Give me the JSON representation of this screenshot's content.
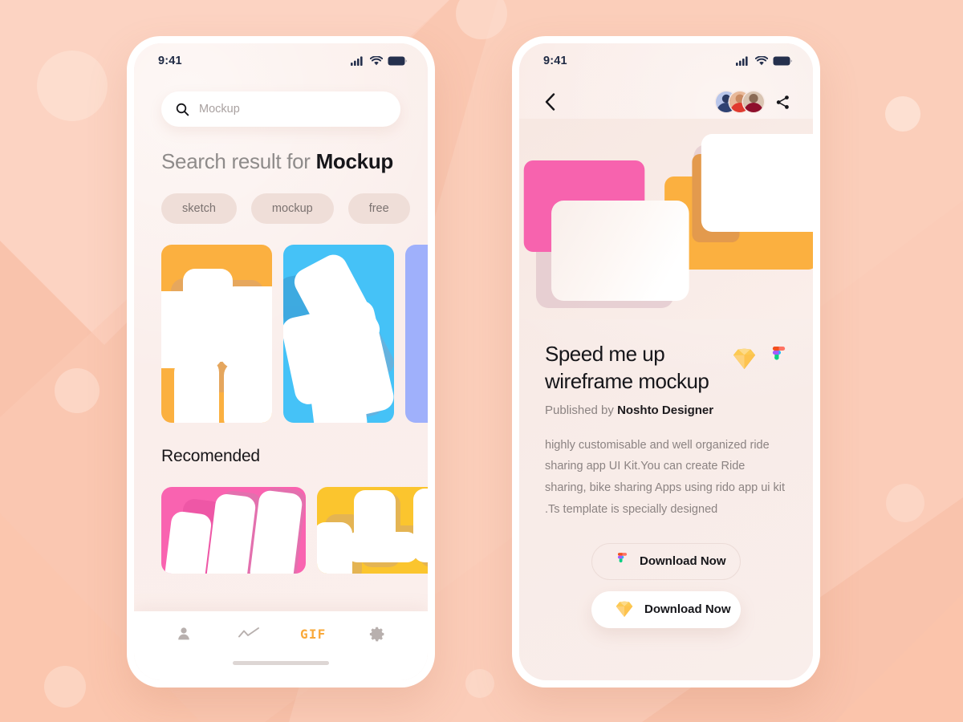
{
  "background": {
    "base_color": "#f9c3ac",
    "accent_light": "#fcd4c1",
    "accent_soft": "#fbdccd"
  },
  "left_screen": {
    "status_bar": {
      "time": "9:41",
      "icons": [
        "signal-icon",
        "wifi-icon",
        "battery-icon"
      ]
    },
    "search": {
      "icon": "search-icon",
      "placeholder": "Mockup",
      "value": ""
    },
    "heading": {
      "prefix": "Search result for ",
      "query": "Mockup"
    },
    "tags": [
      {
        "label": "sketch"
      },
      {
        "label": "mockup"
      },
      {
        "label": "free"
      }
    ],
    "results": [
      {
        "name": "result-card-orange",
        "color": "#fbb040"
      },
      {
        "name": "result-card-blue",
        "color": "#45c2f7"
      },
      {
        "name": "result-card-periwinkle",
        "color": "#9fb0fb"
      }
    ],
    "recommended": {
      "title": "Recomended",
      "cards": [
        {
          "name": "recommended-card-pink",
          "color": "#f963b0"
        },
        {
          "name": "recommended-card-yellow",
          "color": "#fbc52e"
        }
      ]
    },
    "tabbar": {
      "items": [
        {
          "name": "tab-profile",
          "icon": "person-icon",
          "label": "",
          "active": false
        },
        {
          "name": "tab-activity",
          "icon": "activity-line-icon",
          "label": "",
          "active": false
        },
        {
          "name": "tab-gif",
          "icon": "gif-text",
          "label": "GIF",
          "active": true
        },
        {
          "name": "tab-settings",
          "icon": "gear-icon",
          "label": "",
          "active": false
        }
      ],
      "active_color": "#f9a93a",
      "inactive_color": "#b8b0ae"
    }
  },
  "right_screen": {
    "status_bar": {
      "time": "9:41",
      "icons": [
        "signal-icon",
        "wifi-icon",
        "battery-icon"
      ]
    },
    "nav": {
      "back_icon": "chevron-left-icon",
      "share_icon": "share-icon",
      "collaborators": [
        {
          "name": "avatar-1"
        },
        {
          "name": "avatar-2"
        },
        {
          "name": "avatar-3"
        }
      ]
    },
    "hero": {
      "name": "hero-preview-image",
      "colors": {
        "pink": "#f763ae",
        "orange": "#fbb040",
        "white": "#ffffff"
      }
    },
    "detail": {
      "title": "Speed me up\nwireframe mockup",
      "title_line1": "Speed me up",
      "title_line2": "wireframe mockup",
      "format_icons": [
        "sketch-icon",
        "figma-icon"
      ],
      "published_prefix": "Published by ",
      "publisher": "Noshto Designer",
      "description": "highly customisable and well organized ride sharing app UI Kit.You can create Ride sharing, bike sharing Apps using rido app ui kit .Ts template is specially designed"
    },
    "downloads": [
      {
        "name": "download-figma-button",
        "icon": "figma-icon",
        "label": "Download Now",
        "style": "outline"
      },
      {
        "name": "download-sketch-button",
        "icon": "sketch-icon",
        "label": "Download Now",
        "style": "solid"
      }
    ]
  }
}
